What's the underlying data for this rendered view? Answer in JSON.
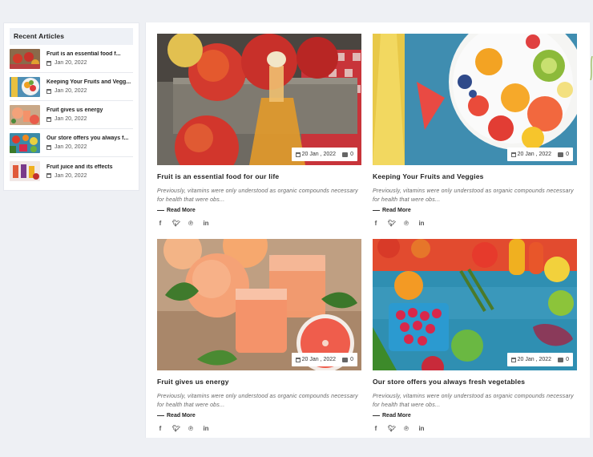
{
  "sidebar": {
    "title": "Recent Articles",
    "items": [
      {
        "label": "Fruit is an essential food f...",
        "date": "Jan 20, 2022"
      },
      {
        "label": "Keeping Your Fruits and Vegg...",
        "date": "Jan 20, 2022"
      },
      {
        "label": "Fruit gives us energy",
        "date": "Jan 20, 2022"
      },
      {
        "label": "Our store offers you always f...",
        "date": "Jan 20, 2022"
      },
      {
        "label": "Fruit juice and its effects",
        "date": "Jan 20, 2022"
      }
    ]
  },
  "cards": [
    {
      "title": "Fruit is an essential food for our life",
      "excerpt": "Previously, vitamins were only understood as organic compounds necessary for health that were obs...",
      "date": "20 Jan , 2022",
      "comments": "0",
      "read_more": "Read More"
    },
    {
      "title": "Keeping Your Fruits and Veggies",
      "excerpt": "Previously, vitamins were only understood as organic compounds necessary for health that were obs...",
      "date": "20 Jan , 2022",
      "comments": "0",
      "read_more": "Read More"
    },
    {
      "title": "Fruit gives us energy",
      "excerpt": "Previously, vitamins were only understood as organic compounds necessary for health that were obs...",
      "date": "20 Jan , 2022",
      "comments": "0",
      "read_more": "Read More"
    },
    {
      "title": "Our store offers you always fresh vegetables",
      "excerpt": "Previously, vitamins were only understood as organic compounds necessary for health that were obs...",
      "date": "20 Jan , 2022",
      "comments": "0",
      "read_more": "Read More"
    }
  ],
  "share_icons": [
    "facebook-icon",
    "twitter-icon",
    "pinterest-icon",
    "linkedin-icon"
  ]
}
